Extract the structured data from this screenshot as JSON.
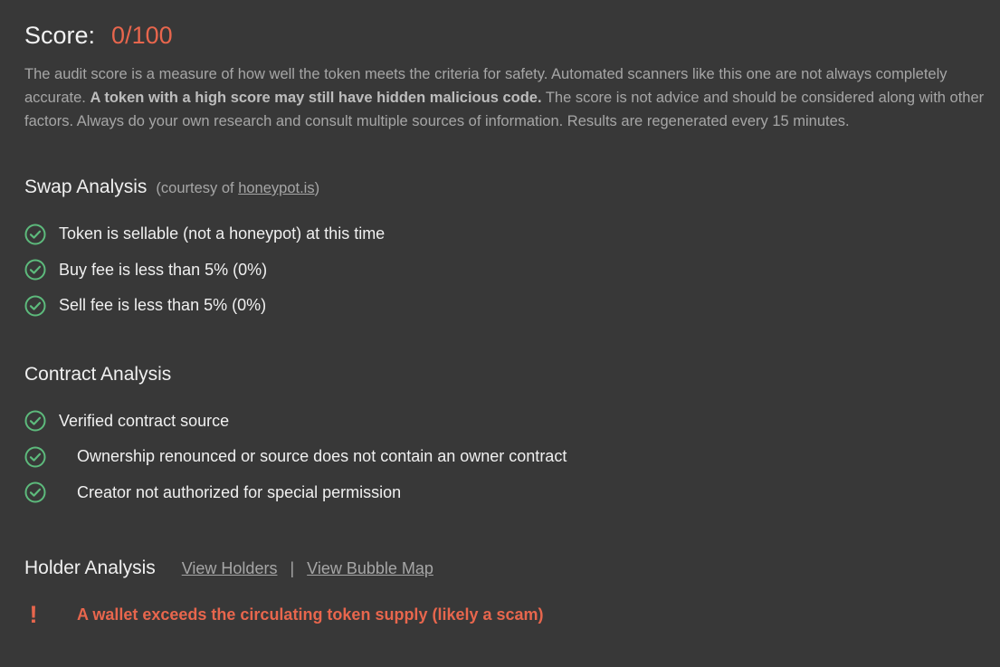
{
  "score": {
    "label": "Score:",
    "value": "0/100"
  },
  "disclaimer": {
    "part1": "The audit score is a measure of how well the token meets the criteria for safety. Automated scanners like this one are not always completely accurate. ",
    "bold": "A token with a high score may still have hidden malicious code.",
    "part2": " The score is not advice and should be considered along with other factors. Always do your own research and consult multiple sources of information. Results are regenerated every 15 minutes."
  },
  "swap": {
    "title": "Swap Analysis",
    "courtesy_prefix": "(courtesy of ",
    "courtesy_link": "honeypot.is",
    "courtesy_suffix": ")",
    "items": [
      "Token is sellable (not a honeypot) at this time",
      "Buy fee is less than 5% (0%)",
      "Sell fee is less than 5% (0%)"
    ]
  },
  "contract": {
    "title": "Contract Analysis",
    "items": [
      "Verified contract source",
      "Ownership renounced or source does not contain an owner contract",
      "Creator not authorized for special permission"
    ]
  },
  "holder": {
    "title": "Holder Analysis",
    "view_holders": "View Holders",
    "separator": "|",
    "view_bubble_map": "View Bubble Map",
    "alert_icon": "!",
    "alert_text": "A wallet exceeds the circulating token supply (likely a scam)"
  },
  "colors": {
    "background": "#383838",
    "success": "#5dba7c",
    "danger": "#e8664d",
    "muted": "#a6a6a6"
  },
  "icons": {
    "check": "check-circle-icon",
    "alert": "exclamation-icon"
  }
}
